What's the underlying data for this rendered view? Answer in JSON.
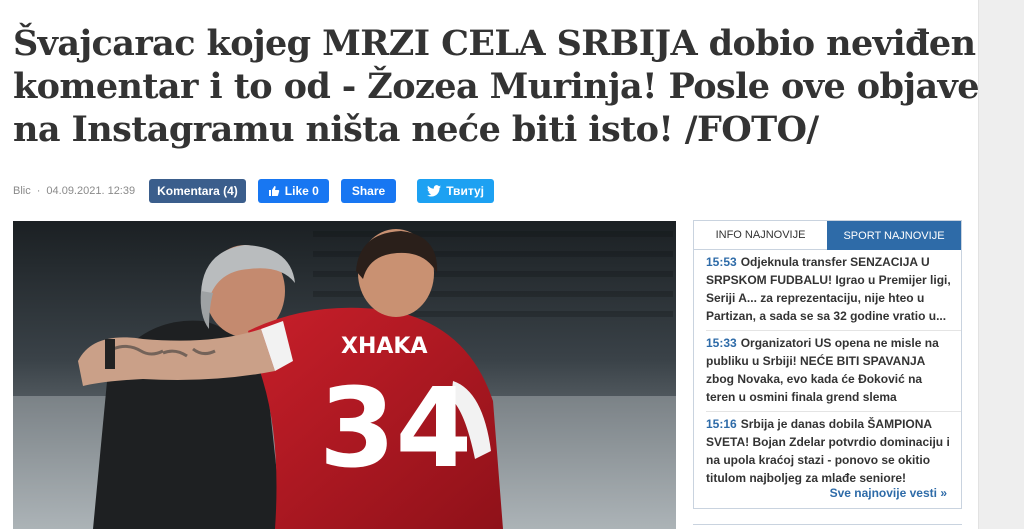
{
  "article": {
    "title_lines": [
      "Švajcarac kojeg MRZI CELA SRBIJA dobio neviđen",
      "komentar i to od - Žozea Murinja! Posle ove objave",
      "na Instagramu ništa neće biti isto! /FOTO/"
    ],
    "source": "Blic",
    "separator": "·",
    "date": "04.09.2021. 12:39",
    "comments_label": "Komentara (4)",
    "like_label": "Like 0",
    "share_label": "Share",
    "tweet_label": "Твитуј",
    "photo": {
      "jersey_name": "XHAKA",
      "jersey_number": "34"
    }
  },
  "sidebar": {
    "tabs": [
      "INFO NAJNOVIJE",
      "SPORT NAJNOVIJE"
    ],
    "active_tab": "SPORT NAJNOVIJE",
    "items": [
      {
        "time": "15:53",
        "lines": [
          "Odjeknula transfer SENZACIJA U",
          "SRPSKOM FUDBALU! Igrao u Premijer ligi,",
          "Seriji A... za reprezentaciju, nije hteo u",
          "Partizan, a sada se sa 32 godine vratio u..."
        ]
      },
      {
        "time": "15:33",
        "lines": [
          "Organizatori US opena ne misle na",
          "publiku u Srbiji! NEĆE BITI SPAVANJA",
          "zbog Novaka, evo kada će Đoković na",
          "teren u osmini finala grend slema"
        ]
      },
      {
        "time": "15:16",
        "lines": [
          "Srbija je danas dobila ŠAMPIONA",
          "SVETA! Bojan Zdelar potvrdio dominaciju i",
          "na upola kraćoj stazi - ponovo se okitio",
          "titulom najboljeg za mlađe seniore!"
        ]
      }
    ],
    "more_label": "Sve najnovije vesti",
    "more_arrow": "»"
  },
  "colors": {
    "accent": "#2e6ba8",
    "comments_button": "#3b5e8c",
    "facebook": "#1877f2",
    "twitter": "#1da1f2",
    "headline": "#333333"
  }
}
